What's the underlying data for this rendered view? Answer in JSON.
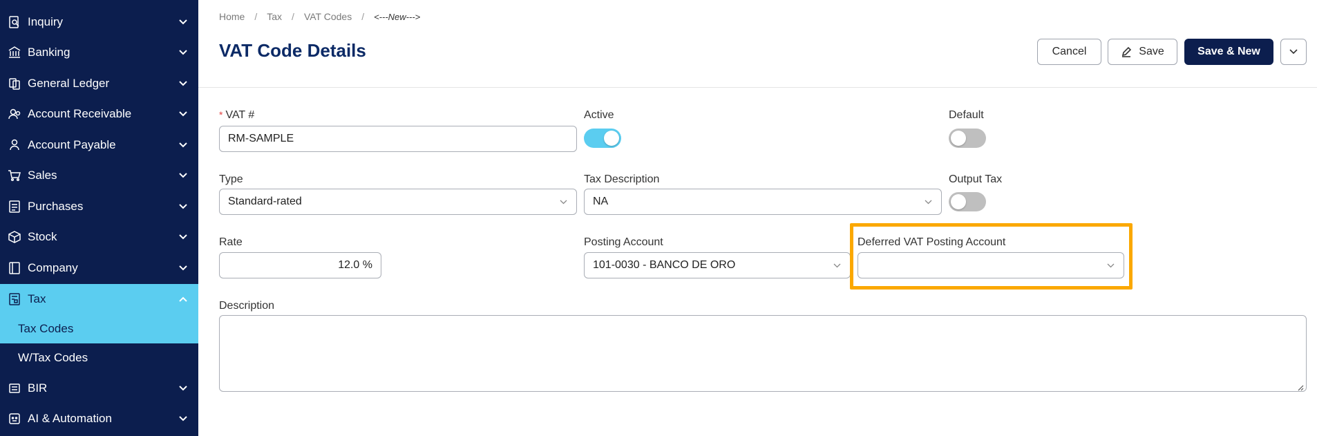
{
  "sidebar": {
    "items": [
      {
        "label": "Inquiry",
        "icon": "inquiry-icon"
      },
      {
        "label": "Banking",
        "icon": "bank-icon"
      },
      {
        "label": "General Ledger",
        "icon": "ledger-icon"
      },
      {
        "label": "Account Receivable",
        "icon": "account-receivable-icon"
      },
      {
        "label": "Account Payable",
        "icon": "account-payable-icon"
      },
      {
        "label": "Sales",
        "icon": "cart-icon"
      },
      {
        "label": "Purchases",
        "icon": "purchases-icon"
      },
      {
        "label": "Stock",
        "icon": "box-icon"
      },
      {
        "label": "Company",
        "icon": "company-icon"
      },
      {
        "label": "Tax",
        "icon": "tax-icon"
      },
      {
        "label": "BIR",
        "icon": "bir-icon"
      },
      {
        "label": "AI & Automation",
        "icon": "ai-icon"
      }
    ],
    "tax_sub": [
      "Tax Codes",
      "W/Tax Codes"
    ],
    "active_color": "#5bcdf0",
    "bg_color": "#0c1e4e"
  },
  "breadcrumb": [
    "Home",
    "Tax",
    "VAT Codes",
    "<---New--->"
  ],
  "header": {
    "title": "VAT Code Details",
    "cancel": "Cancel",
    "save": "Save",
    "save_new": "Save & New"
  },
  "form": {
    "vat_label": "VAT #",
    "vat_value": "RM-SAMPLE",
    "active_label": "Active",
    "active_on": true,
    "default_label": "Default",
    "default_on": false,
    "type_label": "Type",
    "type_value": "Standard-rated",
    "tax_desc_label": "Tax Description",
    "tax_desc_value": "NA",
    "output_tax_label": "Output Tax",
    "output_tax_on": false,
    "rate_label": "Rate",
    "rate_value": "12.0 %",
    "posting_label": "Posting Account",
    "posting_value": "101-0030 - BANCO DE ORO",
    "deferred_label": "Deferred VAT Posting Account",
    "deferred_value": "",
    "description_label": "Description",
    "description_value": ""
  },
  "highlight_color": "#fba800"
}
